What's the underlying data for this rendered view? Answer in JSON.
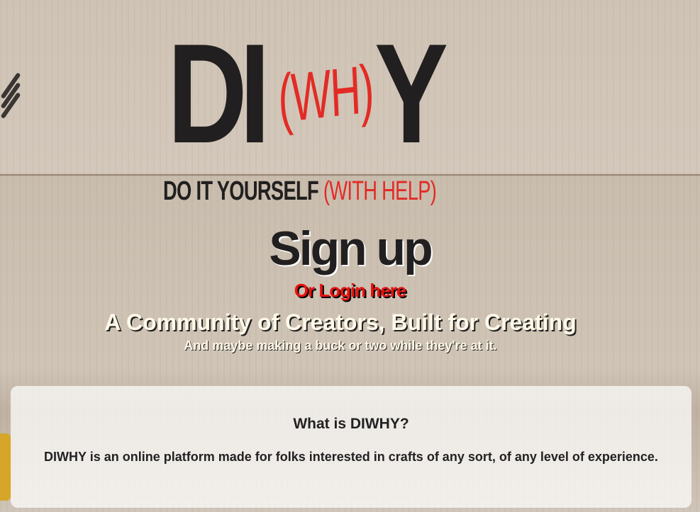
{
  "logo": {
    "letters_di": "DI",
    "letters_wh": "(WH)",
    "letters_y": "Y",
    "tagline_main": "DO IT YOURSELF",
    "tagline_help": "(WITH HELP)"
  },
  "auth": {
    "signup_title": "Sign up",
    "login_link": "Or Login here"
  },
  "hero": {
    "headline": "A Community of Creators, Built for Creating",
    "subline": "And maybe making a buck or two while they're at it."
  },
  "about": {
    "title": "What is DIWHY?",
    "description": "DIWHY is an online platform made for folks interested in crafts of any sort, of any level of experience."
  },
  "colors": {
    "brand_dark": "#211f1f",
    "brand_red": "#e32b25",
    "wood": "#cfc3b5"
  }
}
